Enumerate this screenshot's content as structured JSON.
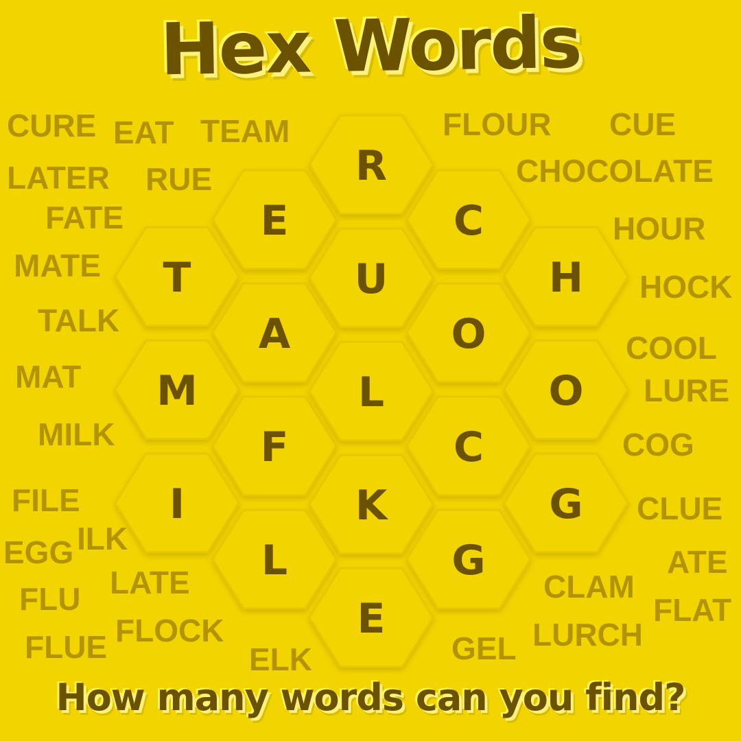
{
  "title": "Hex Words",
  "tagline": "How many words can you find?",
  "colors": {
    "background": "#f2d400",
    "text_dark": "#6b5200",
    "word_muted": "#b39400",
    "highlight": "#fff27a"
  },
  "grid": {
    "columns": [
      {
        "letters": [
          "T",
          "M",
          "I"
        ]
      },
      {
        "letters": [
          "E",
          "A",
          "F",
          "L"
        ]
      },
      {
        "letters": [
          "R",
          "U",
          "L",
          "K",
          "E"
        ]
      },
      {
        "letters": [
          "C",
          "O",
          "C",
          "G"
        ]
      },
      {
        "letters": [
          "H",
          "O",
          "G"
        ]
      }
    ]
  },
  "words": [
    {
      "text": "CURE"
    },
    {
      "text": "EAT"
    },
    {
      "text": "TEAM"
    },
    {
      "text": "LATER"
    },
    {
      "text": "RUE"
    },
    {
      "text": "FATE"
    },
    {
      "text": "MATE"
    },
    {
      "text": "TALK"
    },
    {
      "text": "MAT"
    },
    {
      "text": "MILK"
    },
    {
      "text": "FILE"
    },
    {
      "text": "EGG"
    },
    {
      "text": "ILK"
    },
    {
      "text": "FLU"
    },
    {
      "text": "LATE"
    },
    {
      "text": "FLUE"
    },
    {
      "text": "FLOCK"
    },
    {
      "text": "ELK"
    },
    {
      "text": "GEL"
    },
    {
      "text": "FLOUR"
    },
    {
      "text": "CUE"
    },
    {
      "text": "CHOCOLATE"
    },
    {
      "text": "HOUR"
    },
    {
      "text": "HOCK"
    },
    {
      "text": "COOL"
    },
    {
      "text": "LURE"
    },
    {
      "text": "COG"
    },
    {
      "text": "CLUE"
    },
    {
      "text": "ATE"
    },
    {
      "text": "CLAM"
    },
    {
      "text": "FLAT"
    },
    {
      "text": "LURCH"
    }
  ]
}
